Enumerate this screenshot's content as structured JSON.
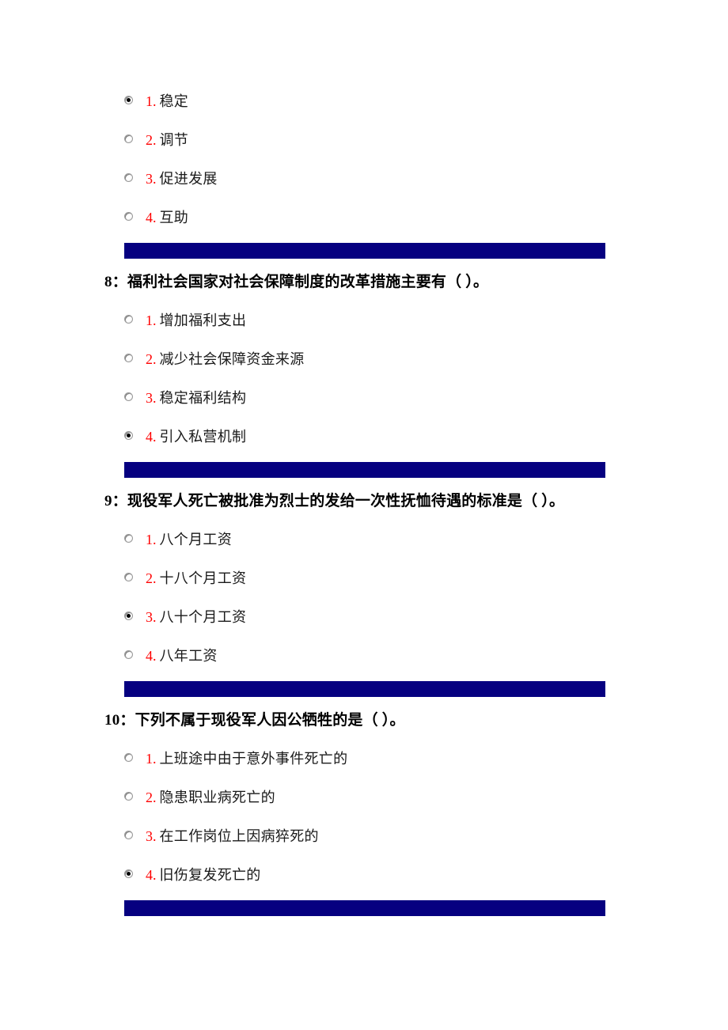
{
  "page": {
    "background_color": "#ffffff",
    "divider_color": "#060080",
    "option_number_color": "#ff0000",
    "option_text_color": "#1a1a1a",
    "heading_color": "#000000"
  },
  "questions": [
    {
      "id": "q7",
      "heading": "",
      "heading_visible": false,
      "options": [
        {
          "num": "1.",
          "text": "稳定",
          "selected": true
        },
        {
          "num": "2.",
          "text": "调节",
          "selected": false
        },
        {
          "num": "3.",
          "text": "促进发展",
          "selected": false
        },
        {
          "num": "4.",
          "text": "互助",
          "selected": false
        }
      ]
    },
    {
      "id": "q8",
      "heading": "8：福利社会国家对社会保障制度的改革措施主要有（ ）。",
      "heading_visible": true,
      "options": [
        {
          "num": "1.",
          "text": "增加福利支出",
          "selected": false
        },
        {
          "num": "2.",
          "text": "减少社会保障资金来源",
          "selected": false
        },
        {
          "num": "3.",
          "text": "稳定福利结构",
          "selected": false
        },
        {
          "num": "4.",
          "text": "引入私营机制",
          "selected": true
        }
      ]
    },
    {
      "id": "q9",
      "heading": "9：现役军人死亡被批准为烈士的发给一次性抚恤待遇的标准是（ ）。",
      "heading_visible": true,
      "options": [
        {
          "num": "1.",
          "text": "八个月工资",
          "selected": false
        },
        {
          "num": "2.",
          "text": "十八个月工资",
          "selected": false
        },
        {
          "num": "3.",
          "text": "八十个月工资",
          "selected": true
        },
        {
          "num": "4.",
          "text": "八年工资",
          "selected": false
        }
      ]
    },
    {
      "id": "q10",
      "heading": "10：下列不属于现役军人因公牺牲的是（ ）。",
      "heading_visible": true,
      "options": [
        {
          "num": "1.",
          "text": "上班途中由于意外事件死亡的",
          "selected": false
        },
        {
          "num": "2.",
          "text": "隐患职业病死亡的",
          "selected": false
        },
        {
          "num": "3.",
          "text": "在工作岗位上因病猝死的",
          "selected": false
        },
        {
          "num": "4.",
          "text": "旧伤复发死亡的",
          "selected": true
        }
      ]
    }
  ]
}
